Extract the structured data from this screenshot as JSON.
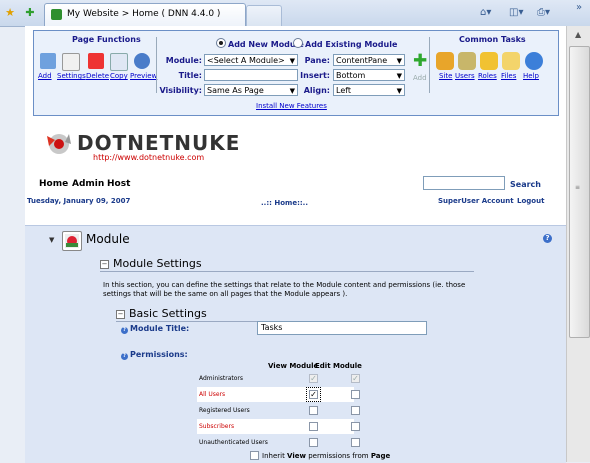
{
  "browser": {
    "tab_title": "My Website > Home ( DNN 4.4.0 )",
    "chevrons": "»"
  },
  "control_panel": {
    "page_functions": {
      "heading": "Page Functions",
      "items": [
        "Add",
        "Settings",
        "Delete",
        "Copy",
        "Preview"
      ]
    },
    "module_mode": {
      "add_new": "Add New Module",
      "add_existing": "Add Existing Module",
      "selected": "Add New Module"
    },
    "fields": {
      "module_label": "Module:",
      "module_value": "<Select A Module>",
      "title_label": "Title:",
      "title_value": "",
      "visibility_label": "Visibility:",
      "visibility_value": "Same As Page",
      "pane_label": "Pane:",
      "pane_value": "ContentPane",
      "insert_label": "Insert:",
      "insert_value": "Bottom",
      "align_label": "Align:",
      "align_value": "Left",
      "add_button": "Add",
      "install_link": "Install New Features"
    },
    "common_tasks": {
      "heading": "Common Tasks",
      "items": [
        "Site",
        "Users",
        "Roles",
        "Files",
        "Help"
      ]
    }
  },
  "header": {
    "logo_text": "DOTNETNUKE",
    "logo_url": "http://www.dotnetnuke.com",
    "menu": [
      "Home",
      "Admin",
      "Host"
    ],
    "search_label": "Search",
    "search_value": "",
    "date": "Tuesday, January 09, 2007",
    "breadcrumb": "..:: Home::..",
    "account_link": "SuperUser Account",
    "logout_link": "Logout"
  },
  "module": {
    "title": "Module",
    "settings_section": "Module Settings",
    "settings_description": "In this section, you can define the settings that relate to the Module content and permissions (ie. those settings that will be the same on all pages that the Module appears ).",
    "basic_section": "Basic Settings",
    "module_title_label": "Module Title:",
    "module_title_value": "Tasks",
    "permissions_label": "Permissions:",
    "perm_headers": [
      "View Module",
      "Edit Module"
    ],
    "permissions": [
      {
        "role": "Administrators",
        "view": true,
        "edit": true,
        "disabled": true,
        "highlight": false
      },
      {
        "role": "All Users",
        "view": true,
        "edit": false,
        "disabled": false,
        "highlight": true
      },
      {
        "role": "Registered Users",
        "view": false,
        "edit": false,
        "disabled": false,
        "highlight": false
      },
      {
        "role": "Subscribers",
        "view": false,
        "edit": false,
        "disabled": false,
        "highlight": true
      },
      {
        "role": "Unauthenticated Users",
        "view": false,
        "edit": false,
        "disabled": false,
        "highlight": false
      }
    ],
    "inherit_pre": "Inherit ",
    "inherit_view": "View",
    "inherit_mid": " permissions from ",
    "inherit_page": "Page",
    "inherit_checked": false
  },
  "colors": {
    "accent": "#1a3a8a",
    "highlight_role": "#cc0000",
    "logo_url": "#cc0000"
  }
}
